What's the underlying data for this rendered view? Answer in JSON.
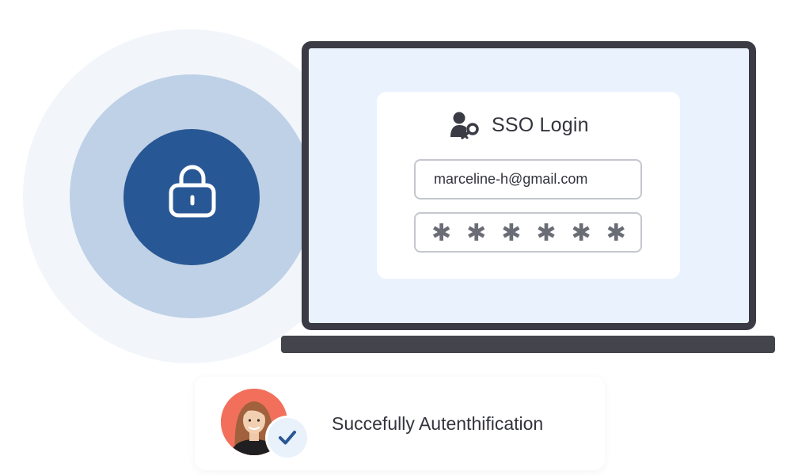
{
  "security_graphic": {
    "icon": "lock-icon",
    "colors": {
      "outer_ring": "#f2f6fb",
      "middle_ring": "#bfd1e6",
      "inner_circle": "#285795"
    }
  },
  "laptop": {
    "frame_color": "#3a3b44",
    "screen_color": "#eaf3fd"
  },
  "login": {
    "icon": "user-key-icon",
    "title": "SSO Login",
    "email_value": "marceline-h@gmail.com",
    "password_mask": "✱✱✱✱✱✱"
  },
  "auth_status": {
    "avatar": "user-avatar",
    "badge_icon": "checkmark-icon",
    "message": "Succefully Autenthification",
    "badge_color": "#285795"
  }
}
